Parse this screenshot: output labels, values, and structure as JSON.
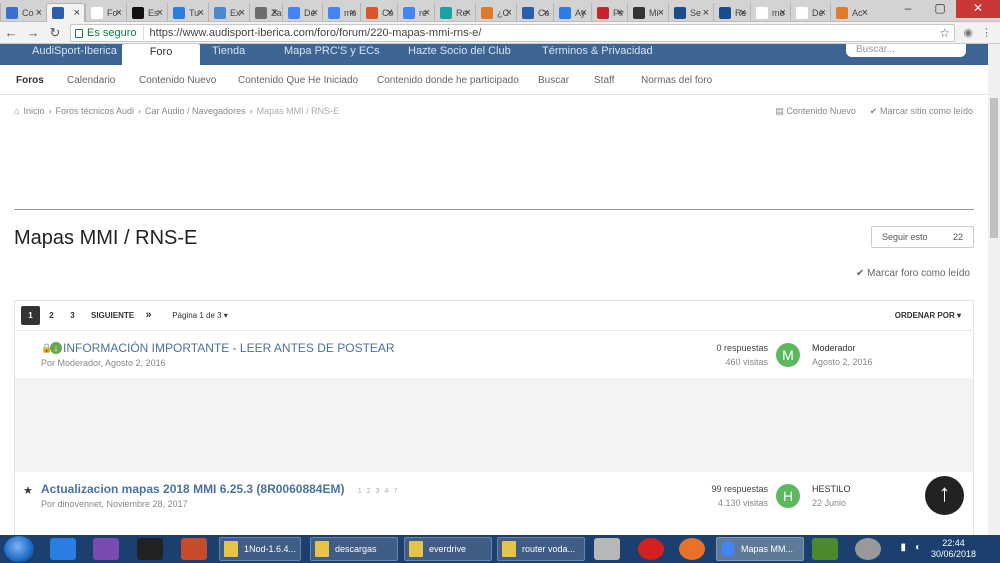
{
  "browser": {
    "tabs": [
      {
        "label": "Co",
        "color": "#3b6fd1"
      },
      {
        "label": "",
        "color": "#2a5ea8",
        "active": true
      },
      {
        "label": "Fo",
        "color": "#ffffff"
      },
      {
        "label": "Es",
        "color": "#111111"
      },
      {
        "label": "Tu",
        "color": "#2a7de1"
      },
      {
        "label": "Ex",
        "color": "#4a8bd0"
      },
      {
        "label": "Za",
        "color": "#6d6d6d"
      },
      {
        "label": "De",
        "color": "#4285f4"
      },
      {
        "label": "mo",
        "color": "#4285f4"
      },
      {
        "label": "Có",
        "color": "#d9572a"
      },
      {
        "label": "re",
        "color": "#4285f4"
      },
      {
        "label": "Re",
        "color": "#1aa1a1"
      },
      {
        "label": "¿C",
        "color": "#e07a2a"
      },
      {
        "label": "Co",
        "color": "#2a5ea8"
      },
      {
        "label": "Ay",
        "color": "#2a7de1"
      },
      {
        "label": "Pir",
        "color": "#c8232c"
      },
      {
        "label": "Mi",
        "color": "#333333"
      },
      {
        "label": "Se",
        "color": "#1a4d8c"
      },
      {
        "label": "Re",
        "color": "#1a4d8c"
      },
      {
        "label": "mo",
        "color": "#ffffff"
      },
      {
        "label": "De",
        "color": "#ffffff"
      },
      {
        "label": "Ac",
        "color": "#e07a2a"
      }
    ],
    "secure_label": "Es seguro",
    "url_scheme": "https://",
    "url_rest": "www.audisport-iberica.com/foro/forum/220-mapas-mmi-rns-e/"
  },
  "site_nav": {
    "items": [
      "AudiSport-Iberica",
      "Foro",
      "Tienda",
      "Mapa PRC'S y ECs",
      "Hazte Socio del Club",
      "Términos & Privacidad"
    ],
    "active": "Foro",
    "search_placeholder": "Buscar..."
  },
  "sub_nav": [
    "Foros",
    "Calendario",
    "Contenido Nuevo",
    "Contenido Que He Iniciado",
    "Contenido donde he participado",
    "Buscar",
    "Staff",
    "Normas del foro"
  ],
  "breadcrumb": [
    "Inicio",
    "Foros técnicos Audi",
    "Car Audio / Navegadores",
    "Mapas MMI / RNS-E"
  ],
  "breadcrumb_right": [
    "Contenido Nuevo",
    "Marcar sitio como leído"
  ],
  "page_title": "Mapas MMI / RNS-E",
  "follow": {
    "label": "Seguir esto",
    "count": "22"
  },
  "mark_forum_read": "Marcar foro como leído",
  "pagination": {
    "pages": [
      "1",
      "2",
      "3"
    ],
    "next": "SIGUIENTE",
    "last": "»",
    "page_of": "Página 1 de 3",
    "sort": "ORDENAR POR"
  },
  "topics": [
    {
      "title": "INFORMACIÓN IMPORTANTE - LEER ANTES DE POSTEAR",
      "meta": "Por Moderador, Agosto 2, 2016",
      "replies": "0 respuestas",
      "views": "460 visitas",
      "avatar_letter": "M",
      "avatar_color": "#5cb85c",
      "last_user": "Moderador",
      "last_date": "Agosto 2, 2016"
    },
    {
      "title": "Actualizacion mapas 2018 MMI 6.25.3 (8R0060884EM)",
      "meta": "Por dinovennet, Noviembre 28, 2017",
      "mini_pages": [
        "1",
        "2",
        "3",
        "4",
        "7"
      ],
      "replies": "99 respuestas",
      "views": "4.130 visitas",
      "avatar_letter": "H",
      "avatar_color": "#5cb85c",
      "last_user": "HESTILO",
      "last_date": "22 Junio"
    }
  ],
  "taskbar": {
    "tasks": [
      "1Nod-1.6.4...",
      "descargas",
      "everdrive",
      "router voda...",
      "Mapas MM..."
    ],
    "time": "22:44",
    "date": "30/06/2018"
  }
}
